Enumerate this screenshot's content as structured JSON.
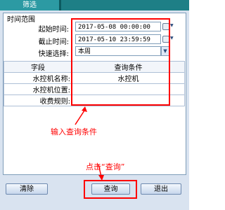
{
  "window": {
    "tab_label": "筛选"
  },
  "time_range": {
    "group_label": "时间范围",
    "start_label": "起始时间:",
    "start_value": "2017-05-08 00:00:00",
    "end_label": "截止时间:",
    "end_value": "2017-05-10 23:59:59",
    "quick_label": "快速选择:",
    "quick_value": "本周"
  },
  "table": {
    "columns": [
      "字段",
      "查询条件"
    ],
    "rows": [
      {
        "field": "水控机名称:",
        "value": "水控机"
      },
      {
        "field": "水控机位置:",
        "value": ""
      },
      {
        "field": "收费规则:",
        "value": ""
      }
    ]
  },
  "annotations": {
    "input_hint": "输入查询条件",
    "click_hint": "点击“查询”"
  },
  "buttons": {
    "clear": "清除",
    "query": "查询",
    "exit": "退出"
  },
  "colors": {
    "accent_red": "#ff0000",
    "frame_bg": "#d9e3f0",
    "tab_bg": "#2c9aa3"
  }
}
